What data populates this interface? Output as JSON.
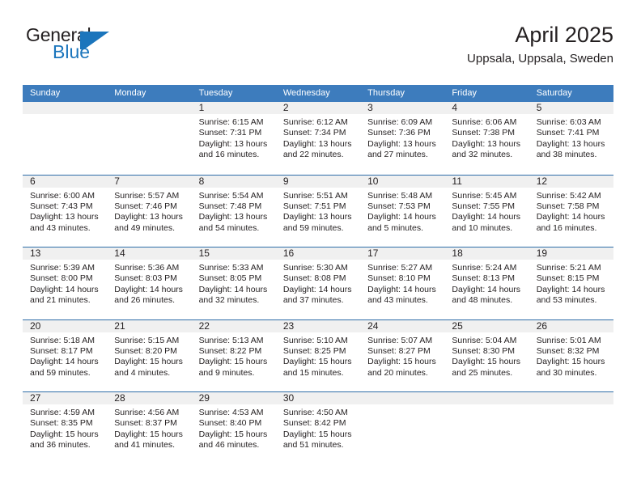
{
  "brand": {
    "name_top": "General",
    "name_bottom": "Blue",
    "mark": "blue-triangle-flag",
    "accent_color": "#1b75bc"
  },
  "header": {
    "title": "April 2025",
    "subtitle": "Uppsala, Uppsala, Sweden"
  },
  "theme": {
    "header_blue": "#3d7cbd",
    "rule_blue": "#2e6da8",
    "daynum_band": "#f0f0f0",
    "text": "#231f20"
  },
  "weekdays": [
    "Sunday",
    "Monday",
    "Tuesday",
    "Wednesday",
    "Thursday",
    "Friday",
    "Saturday"
  ],
  "weeks": [
    [
      {
        "day": ""
      },
      {
        "day": ""
      },
      {
        "day": "1",
        "sunrise": "Sunrise: 6:15 AM",
        "sunset": "Sunset: 7:31 PM",
        "daylight": "Daylight: 13 hours and 16 minutes."
      },
      {
        "day": "2",
        "sunrise": "Sunrise: 6:12 AM",
        "sunset": "Sunset: 7:34 PM",
        "daylight": "Daylight: 13 hours and 22 minutes."
      },
      {
        "day": "3",
        "sunrise": "Sunrise: 6:09 AM",
        "sunset": "Sunset: 7:36 PM",
        "daylight": "Daylight: 13 hours and 27 minutes."
      },
      {
        "day": "4",
        "sunrise": "Sunrise: 6:06 AM",
        "sunset": "Sunset: 7:38 PM",
        "daylight": "Daylight: 13 hours and 32 minutes."
      },
      {
        "day": "5",
        "sunrise": "Sunrise: 6:03 AM",
        "sunset": "Sunset: 7:41 PM",
        "daylight": "Daylight: 13 hours and 38 minutes."
      }
    ],
    [
      {
        "day": "6",
        "sunrise": "Sunrise: 6:00 AM",
        "sunset": "Sunset: 7:43 PM",
        "daylight": "Daylight: 13 hours and 43 minutes."
      },
      {
        "day": "7",
        "sunrise": "Sunrise: 5:57 AM",
        "sunset": "Sunset: 7:46 PM",
        "daylight": "Daylight: 13 hours and 49 minutes."
      },
      {
        "day": "8",
        "sunrise": "Sunrise: 5:54 AM",
        "sunset": "Sunset: 7:48 PM",
        "daylight": "Daylight: 13 hours and 54 minutes."
      },
      {
        "day": "9",
        "sunrise": "Sunrise: 5:51 AM",
        "sunset": "Sunset: 7:51 PM",
        "daylight": "Daylight: 13 hours and 59 minutes."
      },
      {
        "day": "10",
        "sunrise": "Sunrise: 5:48 AM",
        "sunset": "Sunset: 7:53 PM",
        "daylight": "Daylight: 14 hours and 5 minutes."
      },
      {
        "day": "11",
        "sunrise": "Sunrise: 5:45 AM",
        "sunset": "Sunset: 7:55 PM",
        "daylight": "Daylight: 14 hours and 10 minutes."
      },
      {
        "day": "12",
        "sunrise": "Sunrise: 5:42 AM",
        "sunset": "Sunset: 7:58 PM",
        "daylight": "Daylight: 14 hours and 16 minutes."
      }
    ],
    [
      {
        "day": "13",
        "sunrise": "Sunrise: 5:39 AM",
        "sunset": "Sunset: 8:00 PM",
        "daylight": "Daylight: 14 hours and 21 minutes."
      },
      {
        "day": "14",
        "sunrise": "Sunrise: 5:36 AM",
        "sunset": "Sunset: 8:03 PM",
        "daylight": "Daylight: 14 hours and 26 minutes."
      },
      {
        "day": "15",
        "sunrise": "Sunrise: 5:33 AM",
        "sunset": "Sunset: 8:05 PM",
        "daylight": "Daylight: 14 hours and 32 minutes."
      },
      {
        "day": "16",
        "sunrise": "Sunrise: 5:30 AM",
        "sunset": "Sunset: 8:08 PM",
        "daylight": "Daylight: 14 hours and 37 minutes."
      },
      {
        "day": "17",
        "sunrise": "Sunrise: 5:27 AM",
        "sunset": "Sunset: 8:10 PM",
        "daylight": "Daylight: 14 hours and 43 minutes."
      },
      {
        "day": "18",
        "sunrise": "Sunrise: 5:24 AM",
        "sunset": "Sunset: 8:13 PM",
        "daylight": "Daylight: 14 hours and 48 minutes."
      },
      {
        "day": "19",
        "sunrise": "Sunrise: 5:21 AM",
        "sunset": "Sunset: 8:15 PM",
        "daylight": "Daylight: 14 hours and 53 minutes."
      }
    ],
    [
      {
        "day": "20",
        "sunrise": "Sunrise: 5:18 AM",
        "sunset": "Sunset: 8:17 PM",
        "daylight": "Daylight: 14 hours and 59 minutes."
      },
      {
        "day": "21",
        "sunrise": "Sunrise: 5:15 AM",
        "sunset": "Sunset: 8:20 PM",
        "daylight": "Daylight: 15 hours and 4 minutes."
      },
      {
        "day": "22",
        "sunrise": "Sunrise: 5:13 AM",
        "sunset": "Sunset: 8:22 PM",
        "daylight": "Daylight: 15 hours and 9 minutes."
      },
      {
        "day": "23",
        "sunrise": "Sunrise: 5:10 AM",
        "sunset": "Sunset: 8:25 PM",
        "daylight": "Daylight: 15 hours and 15 minutes."
      },
      {
        "day": "24",
        "sunrise": "Sunrise: 5:07 AM",
        "sunset": "Sunset: 8:27 PM",
        "daylight": "Daylight: 15 hours and 20 minutes."
      },
      {
        "day": "25",
        "sunrise": "Sunrise: 5:04 AM",
        "sunset": "Sunset: 8:30 PM",
        "daylight": "Daylight: 15 hours and 25 minutes."
      },
      {
        "day": "26",
        "sunrise": "Sunrise: 5:01 AM",
        "sunset": "Sunset: 8:32 PM",
        "daylight": "Daylight: 15 hours and 30 minutes."
      }
    ],
    [
      {
        "day": "27",
        "sunrise": "Sunrise: 4:59 AM",
        "sunset": "Sunset: 8:35 PM",
        "daylight": "Daylight: 15 hours and 36 minutes."
      },
      {
        "day": "28",
        "sunrise": "Sunrise: 4:56 AM",
        "sunset": "Sunset: 8:37 PM",
        "daylight": "Daylight: 15 hours and 41 minutes."
      },
      {
        "day": "29",
        "sunrise": "Sunrise: 4:53 AM",
        "sunset": "Sunset: 8:40 PM",
        "daylight": "Daylight: 15 hours and 46 minutes."
      },
      {
        "day": "30",
        "sunrise": "Sunrise: 4:50 AM",
        "sunset": "Sunset: 8:42 PM",
        "daylight": "Daylight: 15 hours and 51 minutes."
      },
      {
        "day": ""
      },
      {
        "day": ""
      },
      {
        "day": ""
      }
    ]
  ]
}
